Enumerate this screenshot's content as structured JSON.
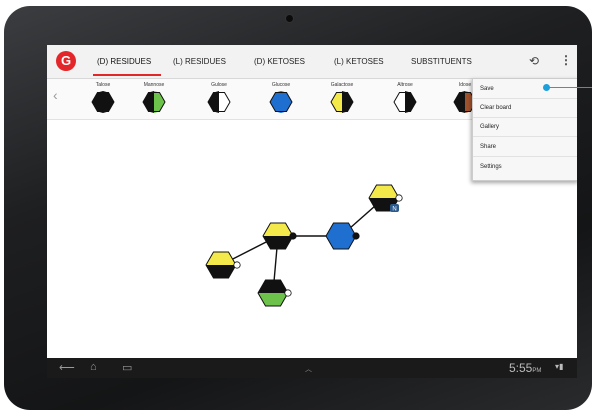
{
  "app": {
    "logo_glyph": "G",
    "brand_color": "#e3262a",
    "tabs": [
      {
        "label": "(D) RESIDUES",
        "active": true
      },
      {
        "label": "(L) RESIDUES",
        "active": false
      },
      {
        "label": "(D) KETOSES",
        "active": false
      },
      {
        "label": "(L) KETOSES",
        "active": false
      },
      {
        "label": "SUBSTITUENTS",
        "active": false
      }
    ],
    "undo_icon": "undo-icon",
    "overflow_icon": "overflow-menu-icon"
  },
  "palette": {
    "scroll_left_icon": "chevron-left-icon",
    "items": [
      {
        "label": "Talose",
        "colors": [
          "#111111",
          "#111111"
        ]
      },
      {
        "label": "Mannose",
        "colors": [
          "#111111",
          "#6cc24a"
        ]
      },
      {
        "label": "Gulose",
        "colors": [
          "#111111",
          "#ffffff"
        ]
      },
      {
        "label": "Glucose",
        "colors": [
          "#1f6fd1",
          "#1f6fd1"
        ]
      },
      {
        "label": "Galactose",
        "colors": [
          "#f4e94a",
          "#111111"
        ]
      },
      {
        "label": "Altrose",
        "colors": [
          "#ffffff",
          "#111111"
        ]
      },
      {
        "label": "Idose",
        "colors": [
          "#111111",
          "#a0522d"
        ]
      }
    ]
  },
  "overflow_menu": {
    "items": [
      "Save",
      "Clear board",
      "Gallery",
      "Share",
      "Settings"
    ],
    "highlight_color": "#1aa0dc"
  },
  "nav": {
    "back_icon": "back-icon",
    "home_icon": "home-icon",
    "recents_icon": "recents-icon",
    "time": "5:55",
    "ampm": "PM"
  },
  "structure": {
    "nodes": [
      {
        "id": "n1",
        "label": "",
        "colors": [
          "#f4e94a",
          "#111111"
        ]
      },
      {
        "id": "n2",
        "label": "",
        "colors": [
          "#f4e94a",
          "#111111"
        ]
      },
      {
        "id": "n3",
        "label": "",
        "colors": [
          "#1f6fd1",
          "#1f6fd1"
        ]
      },
      {
        "id": "n4",
        "label": "N",
        "colors": [
          "#f4e94a",
          "#111111"
        ]
      },
      {
        "id": "n5",
        "label": "",
        "colors": [
          "#111111",
          "#6cc24a"
        ]
      }
    ],
    "link_color": "#111111"
  }
}
